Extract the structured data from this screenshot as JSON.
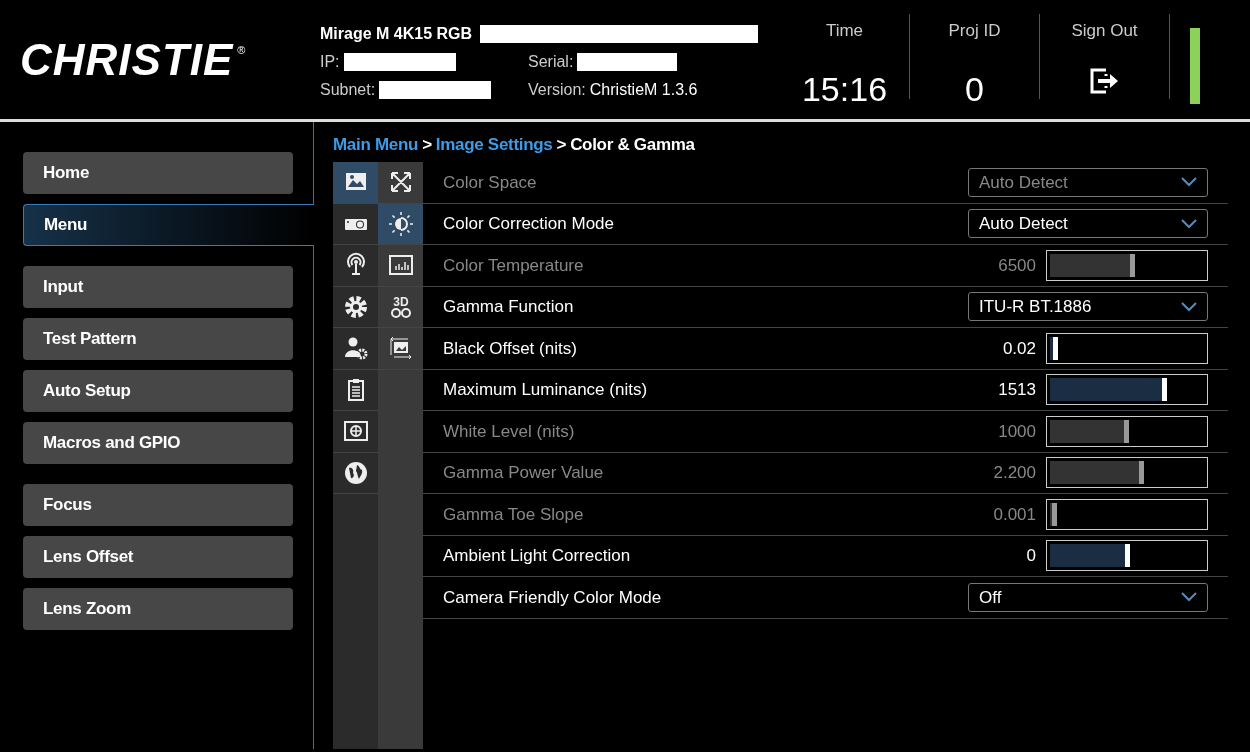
{
  "header": {
    "logo": "CHRISTIE",
    "logo_mark": "®",
    "model": "Mirage M 4K15 RGB",
    "ip_label": "IP:",
    "serial_label": "Serial:",
    "subnet_label": "Subnet:",
    "version_label": "Version:",
    "version": "ChristieM 1.3.6",
    "stats": [
      {
        "label": "Time",
        "value": "15:16",
        "kind": "text"
      },
      {
        "label": "Proj ID",
        "value": "0",
        "kind": "text"
      },
      {
        "label": "Sign Out",
        "kind": "signout"
      }
    ]
  },
  "sidebar": {
    "groups": [
      [
        {
          "label": "Home",
          "selected": false
        },
        {
          "label": "Menu",
          "selected": true
        }
      ],
      [
        {
          "label": "Input",
          "selected": false
        },
        {
          "label": "Test Pattern",
          "selected": false
        },
        {
          "label": "Auto Setup",
          "selected": false
        },
        {
          "label": "Macros and GPIO",
          "selected": false
        }
      ],
      [
        {
          "label": "Focus",
          "selected": false
        },
        {
          "label": "Lens Offset",
          "selected": false
        },
        {
          "label": "Lens Zoom",
          "selected": false
        }
      ]
    ]
  },
  "breadcrumb": [
    {
      "label": "Main Menu",
      "link": true
    },
    {
      "label": "Image Settings",
      "link": true,
      "separator": ">"
    },
    {
      "label": "Color & Gamma",
      "link": false,
      "separator": ">"
    }
  ],
  "category_icons": [
    {
      "kind": "image",
      "selected": true
    },
    {
      "kind": "projector",
      "selected": false
    },
    {
      "kind": "antenna",
      "selected": false
    },
    {
      "kind": "gear",
      "selected": false
    },
    {
      "kind": "user",
      "selected": false
    },
    {
      "kind": "clipboard",
      "selected": false
    },
    {
      "kind": "target",
      "selected": false
    },
    {
      "kind": "globe",
      "selected": false
    }
  ],
  "subcategory_icons": [
    {
      "kind": "resize",
      "selected": false
    },
    {
      "kind": "brightness",
      "selected": true
    },
    {
      "kind": "chart",
      "selected": false
    },
    {
      "kind": "glasses",
      "selected": false,
      "text": "3D"
    },
    {
      "kind": "picture",
      "selected": false
    }
  ],
  "settings": [
    {
      "label": "Color Space",
      "kind": "dropdown",
      "disabled": true,
      "value": "Auto Detect"
    },
    {
      "label": "Color Correction Mode",
      "kind": "dropdown",
      "disabled": false,
      "value": "Auto Detect"
    },
    {
      "label": "Color Temperature",
      "kind": "slider",
      "disabled": true,
      "value": "6500",
      "level": 0.52
    },
    {
      "label": "Gamma Function",
      "kind": "dropdown",
      "disabled": false,
      "value": "ITU-R BT.1886"
    },
    {
      "label": "Black Offset (nits)",
      "kind": "slider",
      "disabled": false,
      "value": "0.02",
      "level": 0.02
    },
    {
      "label": "Maximum Luminance (nits)",
      "kind": "slider",
      "disabled": false,
      "value": "1513",
      "level": 0.73
    },
    {
      "label": "White Level (nits)",
      "kind": "slider",
      "disabled": true,
      "value": "1000",
      "level": 0.48
    },
    {
      "label": "Gamma Power Value",
      "kind": "slider",
      "disabled": true,
      "value": "2.200",
      "level": 0.58
    },
    {
      "label": "Gamma Toe Slope",
      "kind": "slider",
      "disabled": true,
      "value": "0.001",
      "level": 0.01
    },
    {
      "label": "Ambient Light Correction",
      "kind": "slider",
      "disabled": false,
      "value": "0",
      "level": 0.49
    },
    {
      "label": "Camera Friendly Color Mode",
      "kind": "dropdown",
      "disabled": false,
      "value": "Off"
    }
  ]
}
